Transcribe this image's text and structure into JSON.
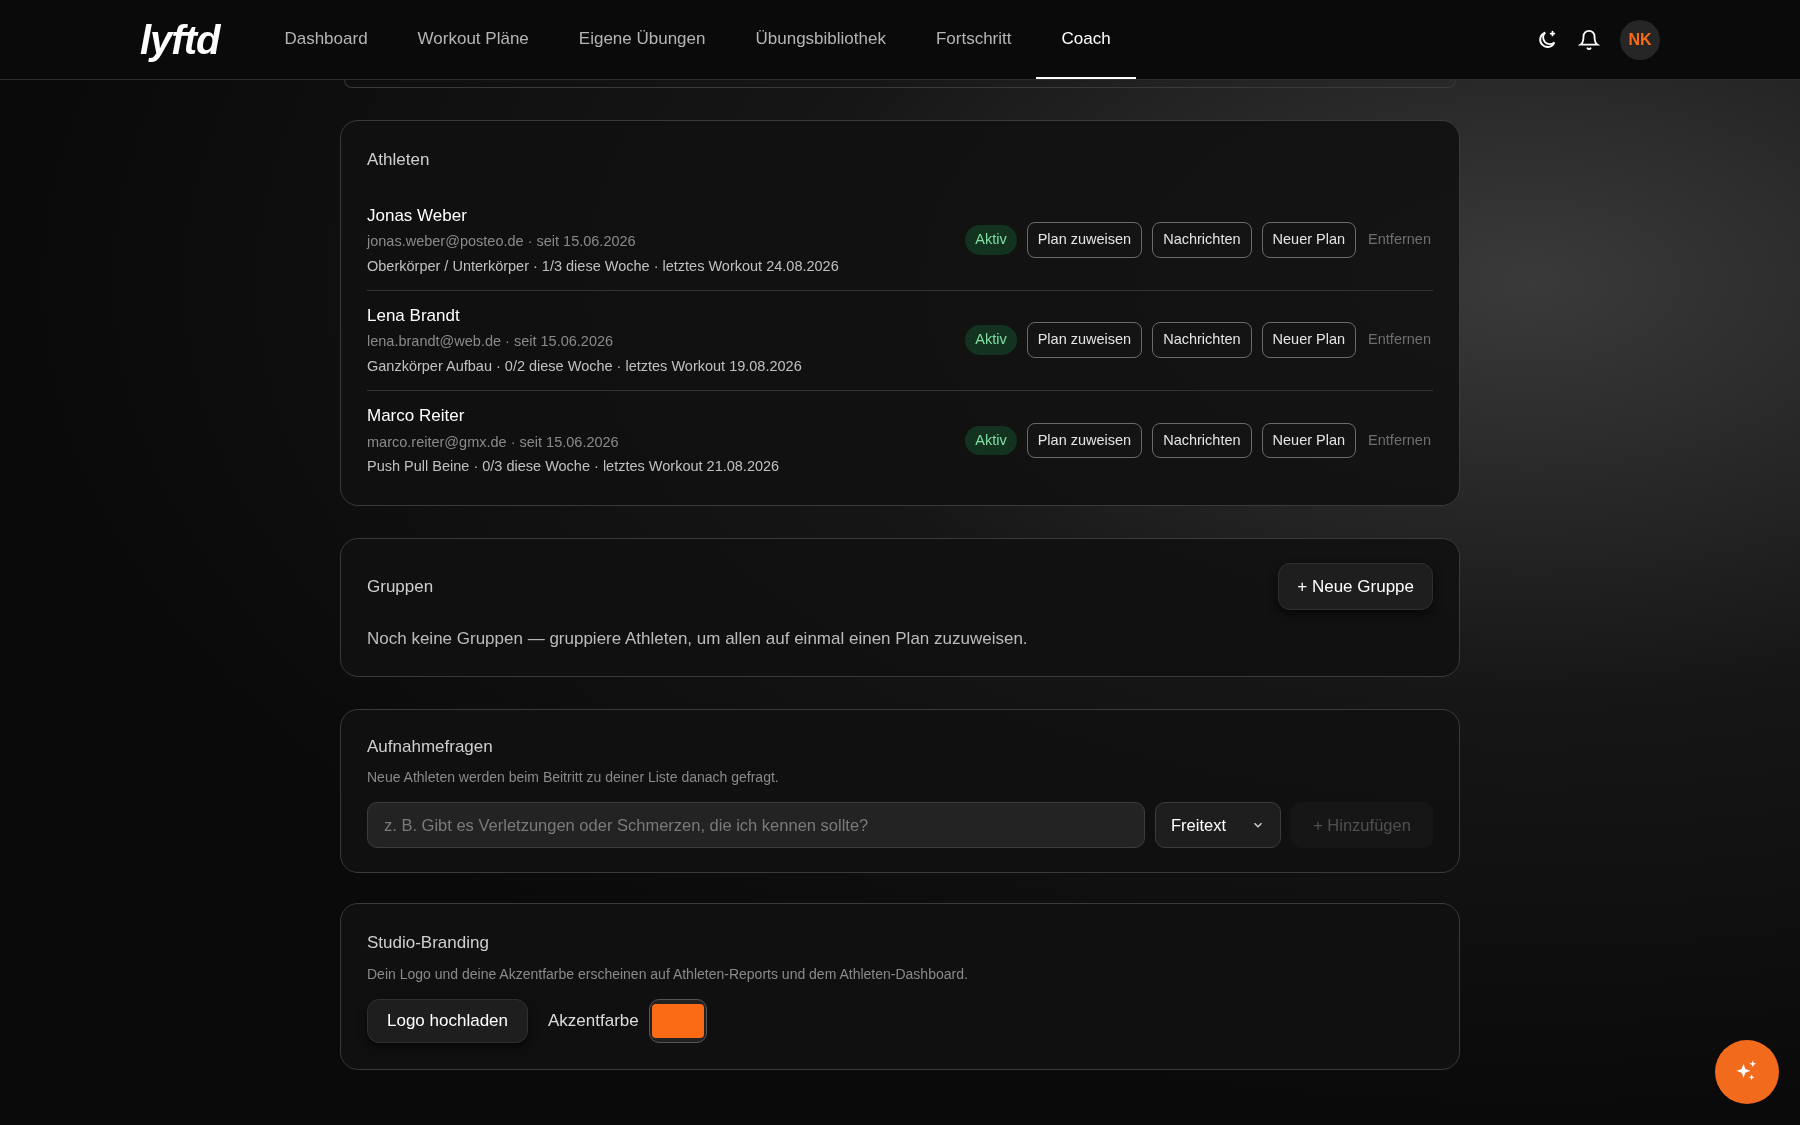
{
  "header": {
    "logo": "lyftd",
    "nav": [
      {
        "label": "Dashboard",
        "selected": false
      },
      {
        "label": "Workout Pläne",
        "selected": false
      },
      {
        "label": "Eigene Übungen",
        "selected": false
      },
      {
        "label": "Übungsbibliothek",
        "selected": false
      },
      {
        "label": "Fortschritt",
        "selected": false
      },
      {
        "label": "Coach",
        "selected": true
      }
    ],
    "avatar": "NK"
  },
  "athletes": {
    "title": "Athleten",
    "rows": [
      {
        "name": "Jonas Weber",
        "contact": "jonas.weber@posteo.de · seit 15.06.2026",
        "summary": "Oberkörper / Unterkörper · 1/3 diese Woche · letztes Workout 24.08.2026",
        "status": "Aktiv",
        "actions": [
          "Plan zuweisen",
          "Nachrichten",
          "Neuer Plan"
        ],
        "remove": "Entfernen"
      },
      {
        "name": "Lena Brandt",
        "contact": "lena.brandt@web.de · seit 15.06.2026",
        "summary": "Ganzkörper Aufbau · 0/2 diese Woche · letztes Workout 19.08.2026",
        "status": "Aktiv",
        "actions": [
          "Plan zuweisen",
          "Nachrichten",
          "Neuer Plan"
        ],
        "remove": "Entfernen"
      },
      {
        "name": "Marco Reiter",
        "contact": "marco.reiter@gmx.de · seit 15.06.2026",
        "summary": "Push Pull Beine · 0/3 diese Woche · letztes Workout 21.08.2026",
        "status": "Aktiv",
        "actions": [
          "Plan zuweisen",
          "Nachrichten",
          "Neuer Plan"
        ],
        "remove": "Entfernen"
      }
    ]
  },
  "groups": {
    "title": "Gruppen",
    "button": "+ Neue Gruppe",
    "empty": "Noch keine Gruppen — gruppiere Athleten, um allen auf einmal einen Plan zuzuweisen."
  },
  "intake": {
    "title": "Aufnahmefragen",
    "description": "Neue Athleten werden beim Beitritt zu deiner Liste danach gefragt.",
    "placeholder": "z. B. Gibt es Verletzungen oder Schmerzen, die ich kennen sollte?",
    "type": "Freitext",
    "add_button": {
      "label": "+ Hinzufügen",
      "disabled": true
    }
  },
  "branding": {
    "title": "Studio-Branding",
    "description": "Dein Logo und deine Akzentfarbe erscheinen auf Athleten-Reports und dem Athleten-Dashboard.",
    "upload_button": "Logo hochladen",
    "accent": {
      "label": "Akzentfarbe",
      "color": "#fb6a14"
    }
  }
}
